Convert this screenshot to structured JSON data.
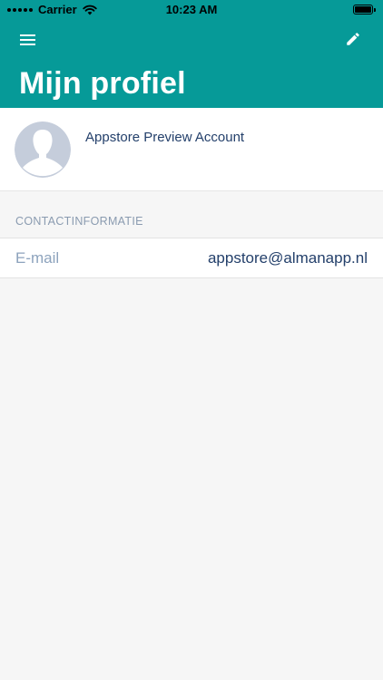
{
  "status_bar": {
    "carrier": "Carrier",
    "time": "10:23 AM"
  },
  "nav": {
    "menu_icon": "hamburger-menu-icon",
    "edit_icon": "pencil-edit-icon"
  },
  "page": {
    "title": "Mijn profiel"
  },
  "profile": {
    "name": "Appstore Preview Account",
    "avatar_icon": "default-person-silhouette"
  },
  "contact": {
    "section_title": "CONTACTINFORMATIE",
    "rows": [
      {
        "label": "E-mail",
        "value": "appstore@almanapp.nl"
      }
    ]
  },
  "colors": {
    "header": "#069a98",
    "text_primary": "#24406b",
    "text_muted": "#8da3bd",
    "background": "#f6f6f6",
    "avatar": "#c5cddb"
  }
}
